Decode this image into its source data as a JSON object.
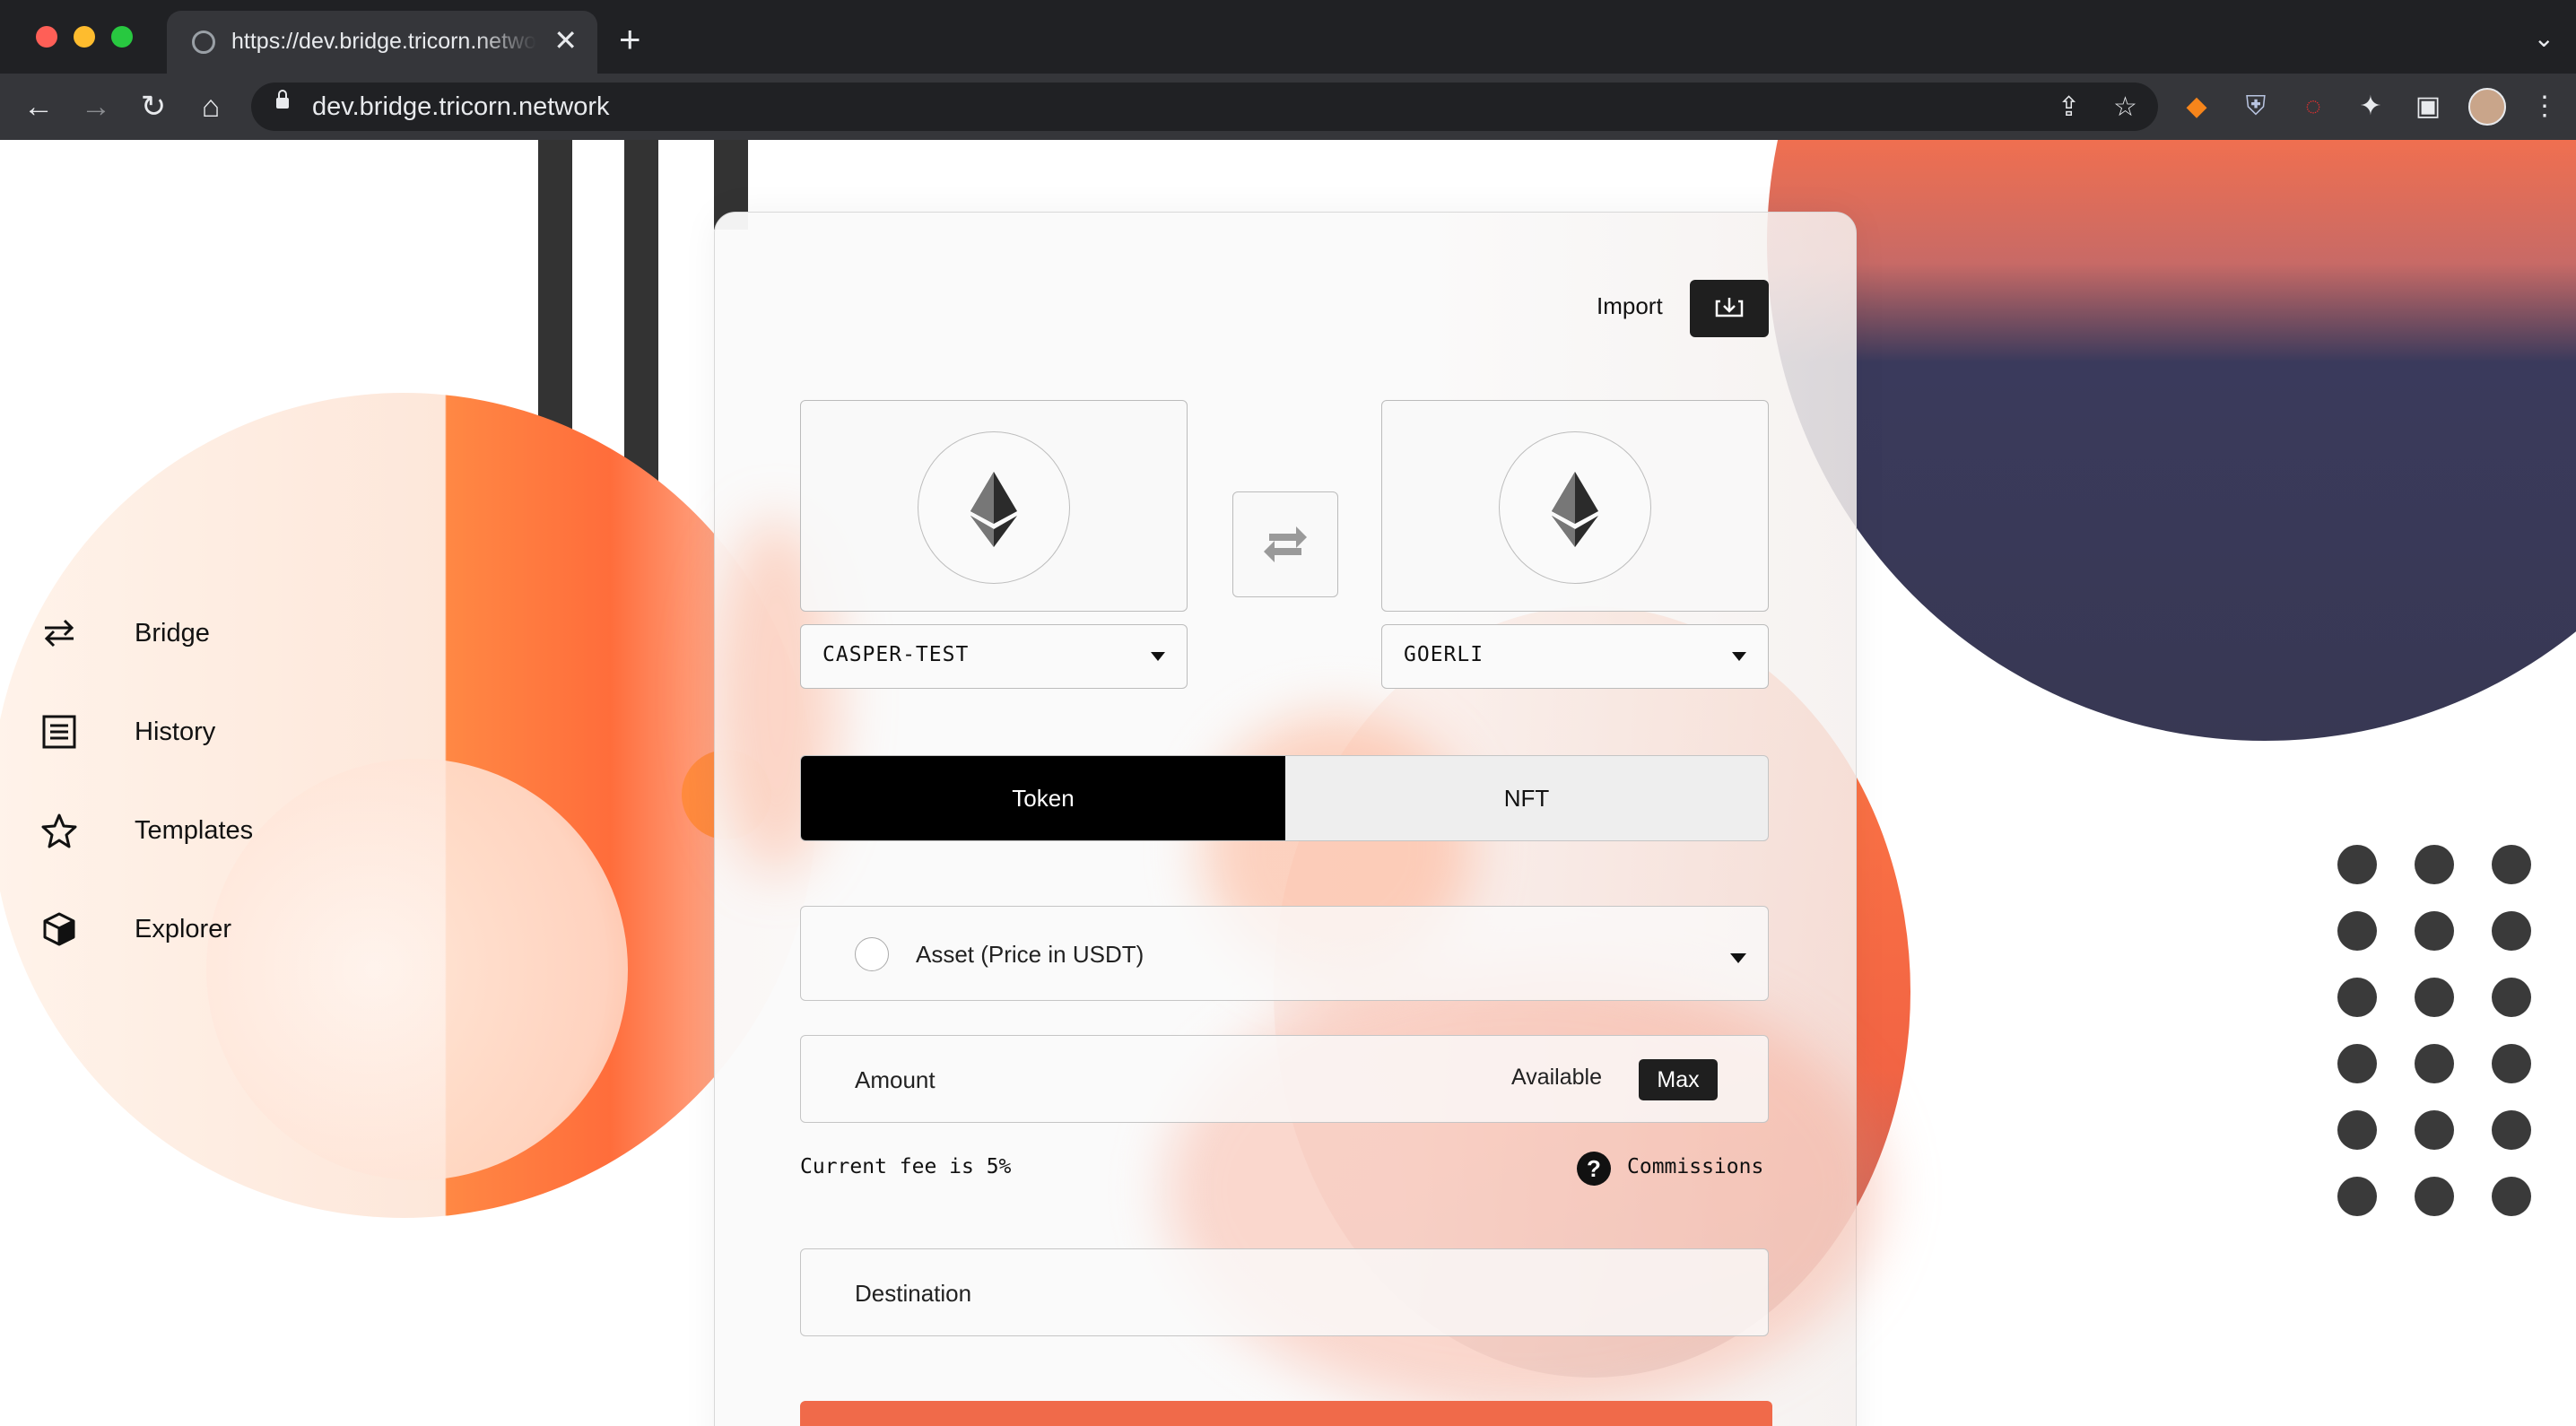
{
  "browser": {
    "tab_title": "https://dev.bridge.tricorn.network",
    "new_tab": "+",
    "close": "✕",
    "url": "dev.bridge.tricorn.network"
  },
  "sidebar": {
    "items": [
      {
        "label": "Bridge",
        "icon": "arrows-exchange-icon"
      },
      {
        "label": "History",
        "icon": "list-document-icon"
      },
      {
        "label": "Templates",
        "icon": "star-icon"
      },
      {
        "label": "Explorer",
        "icon": "cube-icon"
      }
    ]
  },
  "bridge": {
    "import_label": "Import",
    "from_network": "CASPER-TEST",
    "to_network": "GOERLI",
    "tabs": {
      "token": "Token",
      "nft": "NFT"
    },
    "active_tab": "Token",
    "asset_placeholder": "Asset (Price in USDT)",
    "amount_label": "Amount",
    "available_label": "Available",
    "max_label": "Max",
    "fee_text": "Current fee is 5%",
    "help_symbol": "?",
    "commissions_label": "Commissions",
    "destination_label": "Destination"
  },
  "colors": {
    "accent_orange": "#ff7a45",
    "navy": "#383853",
    "toggle_active": "#000000",
    "submit": "#f06a4a"
  }
}
